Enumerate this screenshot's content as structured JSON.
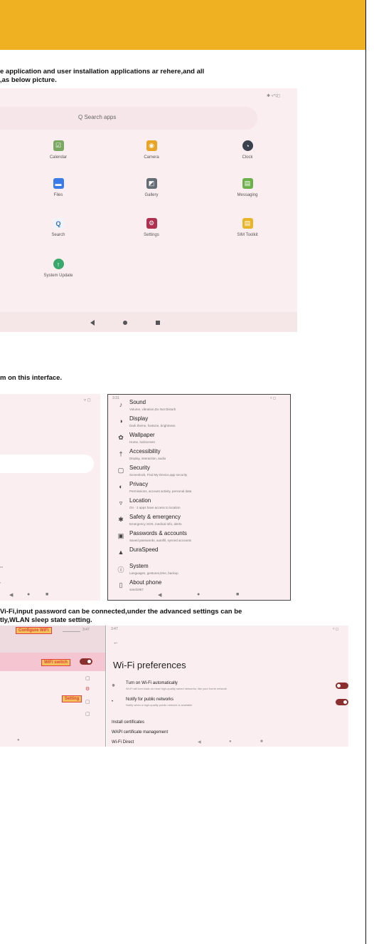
{
  "colors": {
    "banner": "#efb021",
    "screen_bg": "#fbeef0",
    "toggle": "#8a2e2e",
    "callout_text": "#e04040"
  },
  "para1": {
    "line1": "e application and user installation applications ar rehere,and all",
    "line2": ",as below picture."
  },
  "launcher": {
    "status_icons": "✱ ▿◹◻",
    "search_placeholder": "Q  Search apps",
    "apps": [
      {
        "label": "Calendar",
        "icon": "calendar-icon",
        "color": "#7aa860",
        "glyph": "☑"
      },
      {
        "label": "Camera",
        "icon": "camera-icon",
        "color": "#e8a524",
        "glyph": "◉"
      },
      {
        "label": "Clock",
        "icon": "clock-icon",
        "color": "#39424e",
        "glyph": "◔"
      },
      {
        "label": "Files",
        "icon": "files-icon",
        "color": "#3b7be8",
        "glyph": "▬"
      },
      {
        "label": "Gallery",
        "icon": "gallery-icon",
        "color": "#646c76",
        "glyph": "◩"
      },
      {
        "label": "Messaging",
        "icon": "messaging-icon",
        "color": "#6cb04c",
        "glyph": "▤"
      },
      {
        "label": "Search",
        "icon": "search-icon",
        "color": "#eef4fa",
        "glyph": "Q"
      },
      {
        "label": "Settings",
        "icon": "settings-icon",
        "color": "#b03050",
        "glyph": "⚙"
      },
      {
        "label": "SIM Toolkit",
        "icon": "sim-toolkit-icon",
        "color": "#e8b428",
        "glyph": "▤"
      },
      {
        "label": "System Update",
        "icon": "system-update-icon",
        "color": "#3aa86a",
        "glyph": "↑"
      }
    ],
    "nav": {
      "back": "back-icon",
      "home": "home-icon",
      "recent": "recent-apps-icon"
    }
  },
  "para2": {
    "line1": "m on this interface."
  },
  "left_settings": {
    "status": "▿ ◻",
    "nav": [
      "◀",
      "●",
      "■"
    ],
    "truncated_labels": [
      "ns",
      "r",
      "d"
    ]
  },
  "settings": {
    "status_time": "3:31",
    "status_icons": "▿ ◻",
    "items": [
      {
        "title": "Sound",
        "sub": "Volume, vibration,Do Not Disturb",
        "icon": "sound-icon",
        "glyph": "♪"
      },
      {
        "title": "Display",
        "sub": "Dark theme, fontsize, brightness",
        "icon": "display-icon",
        "glyph": "◑"
      },
      {
        "title": "Wallpaper",
        "sub": "Home, lockscreen",
        "icon": "wallpaper-icon",
        "glyph": "✿"
      },
      {
        "title": "Accessibility",
        "sub": "Display, interaction, audio",
        "icon": "accessibility-icon",
        "glyph": "†"
      },
      {
        "title": "Security",
        "sub": "Screenlock, Find My Device,app security",
        "icon": "lock-icon",
        "glyph": "▢"
      },
      {
        "title": "Privacy",
        "sub": "Permissions, account activity, personal data",
        "icon": "privacy-icon",
        "glyph": "◐"
      },
      {
        "title": "Location",
        "sub": "On · 2 apps have access to location",
        "icon": "location-icon",
        "glyph": "▿"
      },
      {
        "title": "Safety & emergency",
        "sub": "Emergency SOS, medical info, alerts",
        "icon": "emergency-icon",
        "glyph": "✱"
      },
      {
        "title": "Passwords & accounts",
        "sub": "Saved passwords, autofill, synced accounts",
        "icon": "account-icon",
        "glyph": "▣"
      },
      {
        "title": "DuraSpeed",
        "sub": "",
        "icon": "duraspeed-icon",
        "glyph": "▲"
      },
      {
        "title": "System",
        "sub": "Languages, gestures,time, backup",
        "icon": "system-icon",
        "glyph": "ⓘ"
      },
      {
        "title": "About phone",
        "sub": "sand1957",
        "icon": "phone-icon",
        "glyph": "▯"
      }
    ],
    "nav": [
      "◀",
      "●",
      "■"
    ]
  },
  "para3": {
    "line1": "Vi-Fi,input password can be connected,under the advanced settings can be",
    "line2": "tly,WLAN sleep state setting."
  },
  "wifi_left": {
    "callout_configure": "Configure WiFi",
    "callout_switch": "WiFi switch",
    "callout_setting": "Setting",
    "status": "3:47",
    "nav_glyph": "●"
  },
  "wifi_prefs": {
    "status_time": "3:47",
    "status_icons": "▿ ◻",
    "back": "←",
    "title": "Wi-Fi preferences",
    "items": [
      {
        "title": "Turn on Wi-Fi automatically",
        "sub": "Wi-Fi will turn back on near high-quality saved networks, like your home network",
        "icon": "wifi-auto-icon",
        "glyph": "✵",
        "toggle": "on"
      },
      {
        "title": "Notify for public networks",
        "sub": "Notify when a high-quality public network is available",
        "icon": "notify-icon",
        "glyph": "•",
        "toggle": "on"
      },
      {
        "title": "Install certificates",
        "sub": "",
        "icon": "",
        "glyph": "",
        "toggle": ""
      },
      {
        "title": "WAPI certificate management",
        "sub": "",
        "icon": "",
        "glyph": "",
        "toggle": ""
      },
      {
        "title": "Wi-Fi Direct",
        "sub": "",
        "icon": "",
        "glyph": "",
        "toggle": ""
      }
    ],
    "nav": [
      "◀",
      "●",
      "■"
    ]
  }
}
